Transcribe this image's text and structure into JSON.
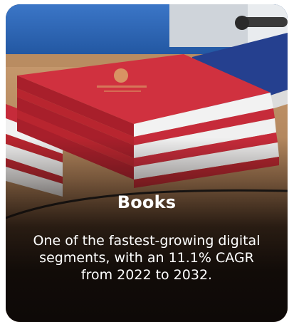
{
  "card": {
    "title": "Books",
    "description": "One of the fastest-growing digital segments, with an 11.1% CAGR from 2022 to 2032."
  },
  "colors": {
    "book_red": "#c62b3a",
    "book_blue": "#26408f",
    "desk_wood": "#b5865a",
    "background_blue": "#1f58a6",
    "text": "#ffffff"
  }
}
